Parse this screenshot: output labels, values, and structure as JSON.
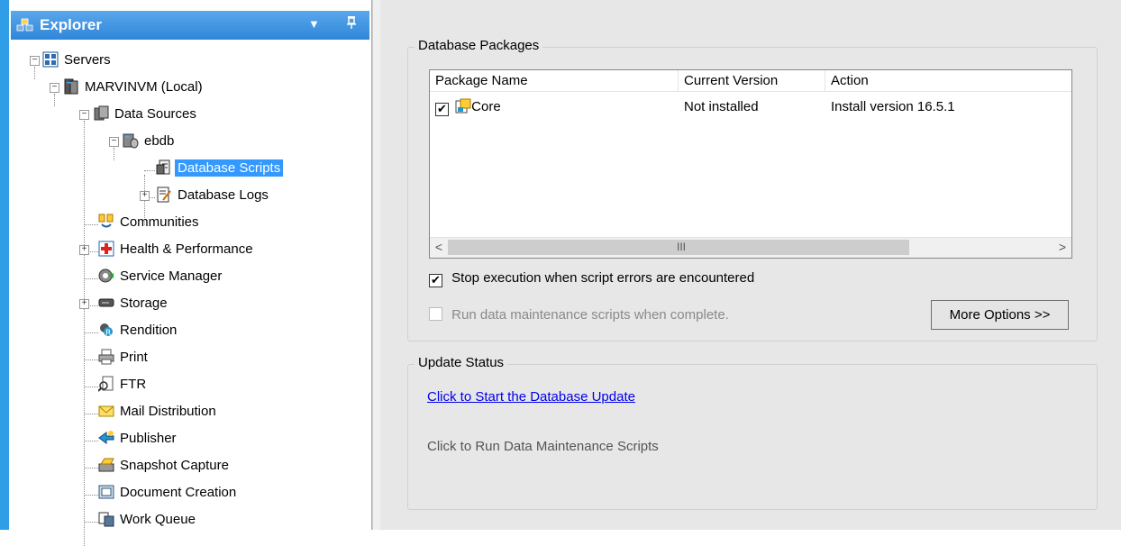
{
  "explorer": {
    "title": "Explorer",
    "dropdown_icon": "chevron-down-icon",
    "pin_icon": "pin-icon"
  },
  "tree": {
    "servers": "Servers",
    "server": "MARVINVM (Local)",
    "data_sources": "Data Sources",
    "ebdb": "ebdb",
    "database_scripts": "Database Scripts",
    "database_logs": "Database Logs",
    "communities": "Communities",
    "health": "Health & Performance",
    "service_manager": "Service Manager",
    "storage": "Storage",
    "rendition": "Rendition",
    "print": "Print",
    "ftr": "FTR",
    "mail": "Mail Distribution",
    "publisher": "Publisher",
    "snapshot": "Snapshot Capture",
    "document_creation": "Document Creation",
    "work_queue": "Work Queue"
  },
  "packages": {
    "group_title": "Database Packages",
    "columns": [
      "Package Name",
      "Current Version",
      "Action"
    ],
    "rows": [
      {
        "checked": true,
        "name": "Core",
        "current_version": "Not installed",
        "action": "Install version 16.5.1"
      }
    ],
    "scroll_grip": "III",
    "stop_on_error_label": "Stop execution when script errors are encountered",
    "stop_on_error_checked": true,
    "run_maintenance_label": "Run data maintenance scripts when complete.",
    "run_maintenance_checked": false,
    "more_options_label": "More Options >>"
  },
  "update_status": {
    "group_title": "Update Status",
    "start_link": "Click to Start the Database Update",
    "run_maintenance_link": "Click to Run Data Maintenance Scripts"
  },
  "colors": {
    "header_blue": "#2f86d8",
    "selection": "#3399ff",
    "panel_bg": "#e7e7e7",
    "link": "#0000ee"
  }
}
